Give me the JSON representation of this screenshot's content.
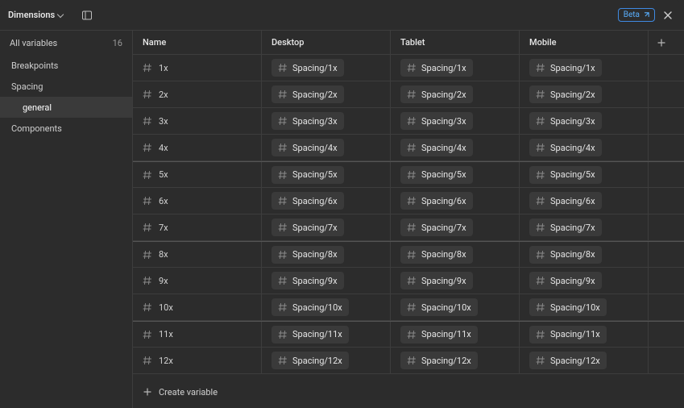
{
  "header": {
    "title": "Dimensions",
    "beta_label": "Beta"
  },
  "sidebar": {
    "all_label": "All variables",
    "count": "16",
    "items": [
      {
        "label": "Breakpoints",
        "children": []
      },
      {
        "label": "Spacing",
        "children": [
          {
            "label": "general",
            "selected": true
          }
        ]
      },
      {
        "label": "Components",
        "children": []
      }
    ]
  },
  "columns": {
    "name": "Name",
    "modes": [
      "Desktop",
      "Tablet",
      "Mobile"
    ]
  },
  "rows": [
    {
      "name": "1x",
      "values": [
        "Spacing/1x",
        "Spacing/1x",
        "Spacing/1x"
      ]
    },
    {
      "name": "2x",
      "values": [
        "Spacing/2x",
        "Spacing/2x",
        "Spacing/2x"
      ]
    },
    {
      "name": "3x",
      "values": [
        "Spacing/3x",
        "Spacing/3x",
        "Spacing/3x"
      ]
    },
    {
      "name": "4x",
      "values": [
        "Spacing/4x",
        "Spacing/4x",
        "Spacing/4x"
      ]
    },
    {
      "name": "5x",
      "values": [
        "Spacing/5x",
        "Spacing/5x",
        "Spacing/5x"
      ],
      "group_start": true
    },
    {
      "name": "6x",
      "values": [
        "Spacing/6x",
        "Spacing/6x",
        "Spacing/6x"
      ]
    },
    {
      "name": "7x",
      "values": [
        "Spacing/7x",
        "Spacing/7x",
        "Spacing/7x"
      ]
    },
    {
      "name": "8x",
      "values": [
        "Spacing/8x",
        "Spacing/8x",
        "Spacing/8x"
      ],
      "group_start": true
    },
    {
      "name": "9x",
      "values": [
        "Spacing/9x",
        "Spacing/9x",
        "Spacing/9x"
      ]
    },
    {
      "name": "10x",
      "values": [
        "Spacing/10x",
        "Spacing/10x",
        "Spacing/10x"
      ]
    },
    {
      "name": "11x",
      "values": [
        "Spacing/11x",
        "Spacing/11x",
        "Spacing/11x"
      ],
      "group_start": true
    },
    {
      "name": "12x",
      "values": [
        "Spacing/12x",
        "Spacing/12x",
        "Spacing/12x"
      ]
    }
  ],
  "footer": {
    "create_label": "Create variable"
  }
}
